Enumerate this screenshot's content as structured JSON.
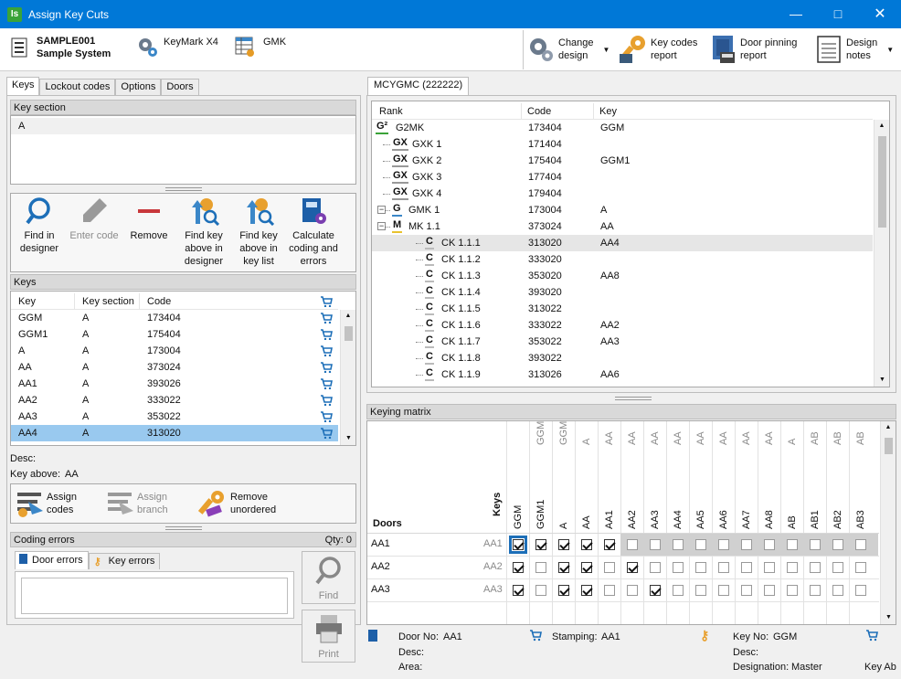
{
  "window": {
    "title": "Assign Key Cuts",
    "app_badge": "Is"
  },
  "toolbar": {
    "system_id": "SAMPLE001",
    "system_name": "Sample System",
    "keymark": "KeyMark X4",
    "gmk": "GMK",
    "change_design": [
      "Change",
      "design"
    ],
    "key_codes_report": [
      "Key codes",
      "report"
    ],
    "door_pinning_report": [
      "Door pinning",
      "report"
    ],
    "design_notes": [
      "Design",
      "notes"
    ]
  },
  "left_tabs": [
    "Keys",
    "Lockout codes",
    "Options",
    "Doors"
  ],
  "key_section": {
    "header": "Key section",
    "items": [
      "A"
    ]
  },
  "actions": [
    {
      "label": [
        "Find in",
        "designer"
      ],
      "enabled": true
    },
    {
      "label": [
        "Enter code"
      ],
      "enabled": false
    },
    {
      "label": [
        "Remove"
      ],
      "enabled": true
    },
    {
      "label": [
        "Find key",
        "above in",
        "designer"
      ],
      "enabled": true
    },
    {
      "label": [
        "Find key",
        "above in",
        "key list"
      ],
      "enabled": true
    },
    {
      "label": [
        "Calculate",
        "coding and",
        "errors"
      ],
      "enabled": true
    }
  ],
  "keys": {
    "header": "Keys",
    "columns": [
      "Key",
      "Key section",
      "Code"
    ],
    "rows": [
      [
        "GGM",
        "A",
        "173404"
      ],
      [
        "GGM1",
        "A",
        "175404"
      ],
      [
        "A",
        "A",
        "173004"
      ],
      [
        "AA",
        "A",
        "373024"
      ],
      [
        "AA1",
        "A",
        "393026"
      ],
      [
        "AA2",
        "A",
        "333022"
      ],
      [
        "AA3",
        "A",
        "353022"
      ],
      [
        "AA4",
        "A",
        "313020"
      ]
    ],
    "selected_index": 7
  },
  "key_info": {
    "desc_label": "Desc:",
    "key_above_label": "Key above:",
    "key_above": "AA"
  },
  "assign": {
    "assign_codes": [
      "Assign",
      "codes"
    ],
    "assign_branch": [
      "Assign",
      "branch"
    ],
    "remove_unordered": [
      "Remove",
      "unordered"
    ]
  },
  "coding_errors": {
    "header": "Coding errors",
    "qty": "Qty: 0",
    "tabs": [
      "Door errors",
      "Key errors"
    ],
    "find": "Find",
    "print": "Print"
  },
  "tree": {
    "tab": "MCYGMC (222222)",
    "columns": [
      "Rank",
      "Code",
      "Key"
    ],
    "rows": [
      {
        "badge": "G²",
        "name": "G2MK",
        "code": "173404",
        "key": "GGM",
        "level": 0
      },
      {
        "badge": "GX",
        "name": "GXK 1",
        "code": "171404",
        "key": "",
        "level": 1
      },
      {
        "badge": "GX",
        "name": "GXK 2",
        "code": "175404",
        "key": "GGM1",
        "level": 1
      },
      {
        "badge": "GX",
        "name": "GXK 3",
        "code": "177404",
        "key": "",
        "level": 1
      },
      {
        "badge": "GX",
        "name": "GXK 4",
        "code": "179404",
        "key": "",
        "level": 1
      },
      {
        "badge": "G",
        "name": "GMK 1",
        "code": "173004",
        "key": "A",
        "level": 1
      },
      {
        "badge": "M",
        "name": "MK 1.1",
        "code": "373024",
        "key": "AA",
        "level": 2
      },
      {
        "badge": "C",
        "name": "CK 1.1.1",
        "code": "313020",
        "key": "AA4",
        "level": 3
      },
      {
        "badge": "C",
        "name": "CK 1.1.2",
        "code": "333020",
        "key": "",
        "level": 3
      },
      {
        "badge": "C",
        "name": "CK 1.1.3",
        "code": "353020",
        "key": "AA8",
        "level": 3
      },
      {
        "badge": "C",
        "name": "CK 1.1.4",
        "code": "393020",
        "key": "",
        "level": 3
      },
      {
        "badge": "C",
        "name": "CK 1.1.5",
        "code": "313022",
        "key": "",
        "level": 3
      },
      {
        "badge": "C",
        "name": "CK 1.1.6",
        "code": "333022",
        "key": "AA2",
        "level": 3
      },
      {
        "badge": "C",
        "name": "CK 1.1.7",
        "code": "353022",
        "key": "AA3",
        "level": 3
      },
      {
        "badge": "C",
        "name": "CK 1.1.8",
        "code": "393022",
        "key": "",
        "level": 3
      },
      {
        "badge": "C",
        "name": "CK 1.1.9",
        "code": "313026",
        "key": "AA6",
        "level": 3
      }
    ],
    "selected_index": 7
  },
  "matrix": {
    "header": "Keying matrix",
    "doors_label": "Doors",
    "keys_label": "Keys",
    "key_cols": [
      {
        "key": "GGM",
        "above": ""
      },
      {
        "key": "GGM1",
        "above": "GGM"
      },
      {
        "key": "A",
        "above": "GGM"
      },
      {
        "key": "AA",
        "above": "A"
      },
      {
        "key": "AA1",
        "above": "AA"
      },
      {
        "key": "AA2",
        "above": "AA"
      },
      {
        "key": "AA3",
        "above": "AA"
      },
      {
        "key": "AA4",
        "above": "AA"
      },
      {
        "key": "AA5",
        "above": "AA"
      },
      {
        "key": "AA6",
        "above": "AA"
      },
      {
        "key": "AA7",
        "above": "AA"
      },
      {
        "key": "AA8",
        "above": "AA"
      },
      {
        "key": "AB",
        "above": "A"
      },
      {
        "key": "AB1",
        "above": "AB"
      },
      {
        "key": "AB2",
        "above": "AB"
      },
      {
        "key": "AB3",
        "above": "AB"
      }
    ],
    "rows": [
      {
        "door": "AA1",
        "key": "AA1",
        "checks": [
          1,
          1,
          1,
          1,
          1,
          0,
          0,
          0,
          0,
          0,
          0,
          0,
          0,
          0,
          0,
          0
        ]
      },
      {
        "door": "AA2",
        "key": "AA2",
        "checks": [
          1,
          0,
          1,
          1,
          0,
          1,
          0,
          0,
          0,
          0,
          0,
          0,
          0,
          0,
          0,
          0
        ]
      },
      {
        "door": "AA3",
        "key": "AA3",
        "checks": [
          1,
          0,
          1,
          1,
          0,
          0,
          1,
          0,
          0,
          0,
          0,
          0,
          0,
          0,
          0,
          0
        ]
      }
    ]
  },
  "statusbar": {
    "door_no_label": "Door No:",
    "door_no": "AA1",
    "stamping_label": "Stamping:",
    "stamping": "AA1",
    "key_no_label": "Key No:",
    "key_no": "GGM",
    "desc_label": "Desc:",
    "area_label": "Area:",
    "desc2_label": "Desc:",
    "designation_label": "Designation:",
    "designation": "Master",
    "key_ab": "Key Ab"
  }
}
